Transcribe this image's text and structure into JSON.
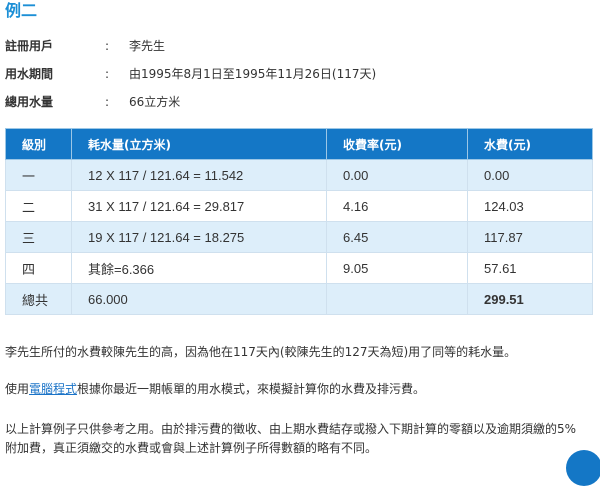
{
  "title": "例二",
  "info": [
    {
      "label": "註冊用戶",
      "colon": ":",
      "value": "李先生"
    },
    {
      "label": "用水期間",
      "colon": ":",
      "value": "由1995年8月1日至1995年11月26日(117天)"
    },
    {
      "label": "總用水量",
      "colon": ":",
      "value": "66立方米"
    }
  ],
  "table": {
    "headers": [
      "級別",
      "耗水量(立方米)",
      "收費率(元)",
      "水費(元)"
    ],
    "rows": [
      [
        "一",
        "12 X 117 / 121.64 = 11.542",
        "0.00",
        "0.00"
      ],
      [
        "二",
        "31 X 117 / 121.64 = 29.817",
        "4.16",
        "124.03"
      ],
      [
        "三",
        "19 X 117 / 121.64 = 18.275",
        "6.45",
        "117.87"
      ],
      [
        "四",
        "其餘=6.366",
        "9.05",
        "57.61"
      ],
      [
        "總共",
        "66.000",
        "",
        "299.51"
      ]
    ]
  },
  "para1": "李先生所付的水費較陳先生的高，因為他在117天內(較陳先生的127天為短)用了同等的耗水量。",
  "para2_prefix": "使用",
  "para2_link": "電腦程式",
  "para2_suffix": "根據你最近一期帳單的用水模式，來模擬計算你的水費及排污費。",
  "para3_line1": "以上計算例子只供參考之用。由於排污費的徵收、由上期水費結存或撥入下期計算的零額以及逾期須繳的5%",
  "para3_line2": "附加費，真正須繳交的水費或會與上述計算例子所得數額的略有不同。",
  "colors": {
    "accent": "#1c8fd6",
    "header": "#1477c6",
    "row_alt": "#ddeefa"
  }
}
